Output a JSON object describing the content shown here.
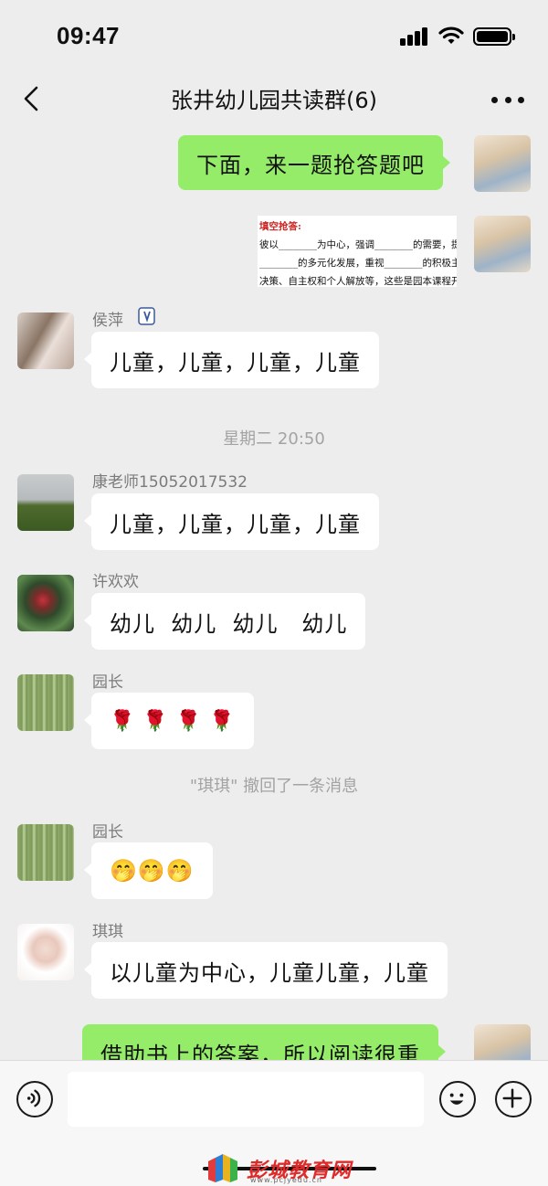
{
  "status_bar": {
    "time": "09:47"
  },
  "nav": {
    "title": "张井幼儿园共读群(6)"
  },
  "messages": {
    "m1": {
      "text": "下面，来一题抢答题吧"
    },
    "quiz": {
      "title": "填空抢答:",
      "line1": "彼以________为中心，强调________的需要，提供",
      "line2": "________的多元化发展，重视________的积极主",
      "line3": "决策、自主权和个人解放等，这些是园本课程开"
    },
    "m3": {
      "sender": "侯萍",
      "text": "儿童，儿童，儿童，儿童"
    },
    "time_divider": "星期二 20:50",
    "m4": {
      "sender": "康老师15052017532",
      "text": "儿童，儿童，儿童，儿童"
    },
    "m5": {
      "sender": "许欢欢",
      "text": "幼儿  幼儿  幼儿   幼儿"
    },
    "m6": {
      "sender": "园长",
      "emoji": "🌹 🌹 🌹 🌹"
    },
    "recall": "\"琪琪\" 撤回了一条消息",
    "m7": {
      "sender": "园长",
      "emoji": "🤭🤭🤭"
    },
    "m8": {
      "sender": "琪琪",
      "text": "以儿童为中心，儿童儿童，儿童"
    },
    "m9": {
      "text": "借助书上的答案，所以阅读很重"
    }
  },
  "watermark": {
    "name": "彭城教育网",
    "url": "www.pcjyedu.cn"
  }
}
